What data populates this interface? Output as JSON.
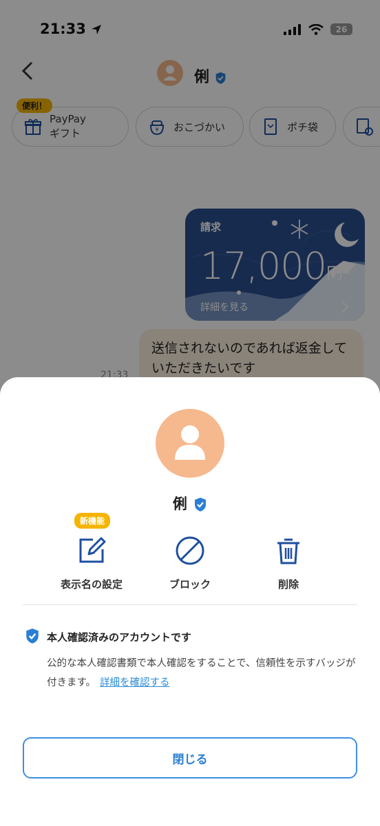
{
  "status_bar": {
    "time": "21:33",
    "battery": "26"
  },
  "header": {
    "name": "俐"
  },
  "quick_actions": {
    "tag": "便利！",
    "items": [
      {
        "label_line1": "PayPay",
        "label_line2": "ギフト"
      },
      {
        "label": "おこづかい"
      },
      {
        "label": "ポチ袋"
      }
    ]
  },
  "chat": {
    "request_card": {
      "label": "請求",
      "amount": "17,000",
      "currency": "円",
      "detail_link": "詳細を見る"
    },
    "message": {
      "text": "送信されないのであれば返金していただきたいです",
      "time": "21:33"
    }
  },
  "sheet": {
    "name": "俐",
    "new_feature_tag": "新機能",
    "actions": {
      "display_name": "表示名の設定",
      "block": "ブロック",
      "delete": "削除"
    },
    "verification": {
      "title": "本人確認済みのアカウントです",
      "body": "公的な本人確認書類で本人確認をすることで、信頼性を示すバッジが付きます。",
      "link": "詳細を確認する"
    },
    "close_button": "閉じる"
  },
  "colors": {
    "accent": "#2a7fd4",
    "avatar": "#f6b88d",
    "badge_yellow": "#f4b400",
    "card_navy": "#2b4f8f",
    "bubble": "#fbeedc"
  }
}
